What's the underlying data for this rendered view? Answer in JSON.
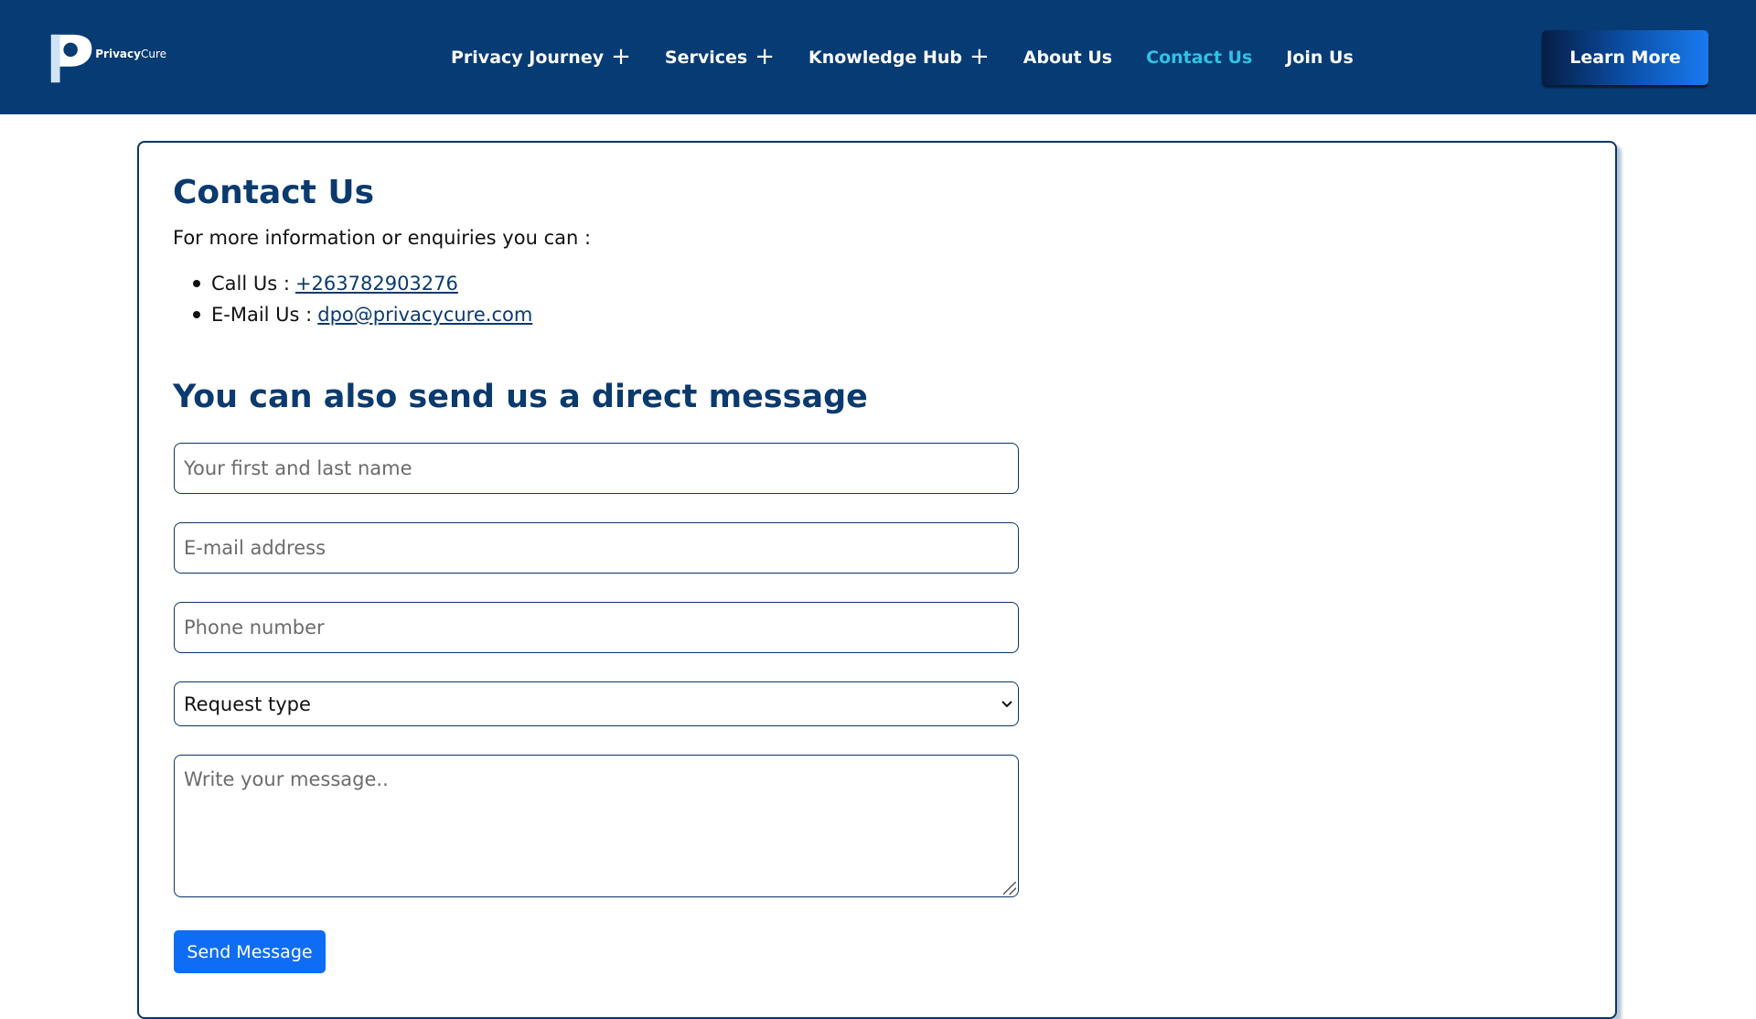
{
  "header": {
    "logo_text_bold": "Privacy",
    "logo_text_light": "Cure",
    "nav": [
      {
        "label": "Privacy Journey",
        "has_plus": true
      },
      {
        "label": "Services",
        "has_plus": true
      },
      {
        "label": "Knowledge Hub",
        "has_plus": true
      },
      {
        "label": "About Us",
        "has_plus": false
      },
      {
        "label": "Contact Us",
        "has_plus": false,
        "active": true
      },
      {
        "label": "Join Us",
        "has_plus": false
      }
    ],
    "plus_symbol": "+",
    "cta_label": "Learn More"
  },
  "contact": {
    "title": "Contact Us",
    "intro": "For more information or enquiries you can :",
    "items": [
      {
        "label": "Call Us :",
        "link": "+263782903276"
      },
      {
        "label": "E-Mail Us :",
        "link": "dpo@privacycure.com"
      }
    ]
  },
  "form": {
    "title": "You can also send us a direct message",
    "name_placeholder": "Your first and last name",
    "email_placeholder": "E-mail address",
    "phone_placeholder": "Phone number",
    "request_type_value": "Request type",
    "message_placeholder": "Write your message..",
    "submit_label": "Send Message"
  },
  "colors": {
    "header_bg": "#073b73",
    "active_nav": "#2fc3e6",
    "heading": "#0b3a6e",
    "primary_button": "#0f6df5"
  }
}
